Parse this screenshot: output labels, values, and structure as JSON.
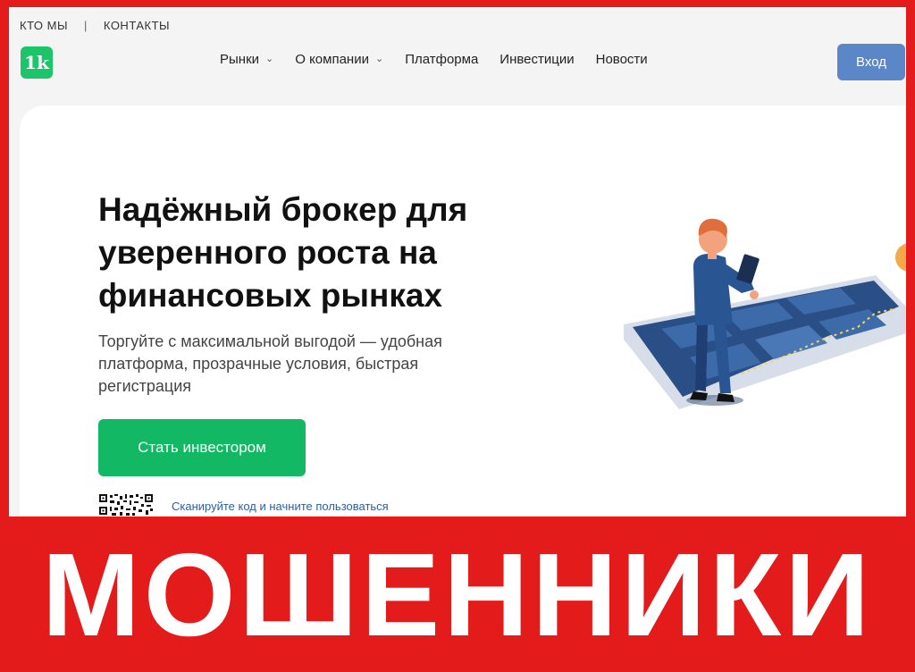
{
  "topbar": {
    "about": "КТО МЫ",
    "separator": "|",
    "contacts": "КОНТАКТЫ"
  },
  "logo": {
    "text": "1k"
  },
  "nav": {
    "items": [
      {
        "label": "Рынки",
        "has_dropdown": true
      },
      {
        "label": "О компании",
        "has_dropdown": true
      },
      {
        "label": "Платформа",
        "has_dropdown": false
      },
      {
        "label": "Инвестиции",
        "has_dropdown": false
      },
      {
        "label": "Новости",
        "has_dropdown": false
      }
    ]
  },
  "login": {
    "label": "Вход"
  },
  "hero": {
    "headline": "Надёжный брокер для уверенного роста на финансовых рынках",
    "subtitle": "Торгуйте с максимальной выгодой — удобная платформа, прозрачные условия, быстрая регистрация",
    "cta_label": "Стать инвестором",
    "qr_text": "Сканируйте код и начните пользоваться"
  },
  "banner": {
    "text": "МОШЕННИКИ"
  },
  "colors": {
    "banner_red": "#e31b1b",
    "brand_green": "#12b864",
    "login_blue": "#5b86c8",
    "link_blue": "#2c5f9e"
  }
}
